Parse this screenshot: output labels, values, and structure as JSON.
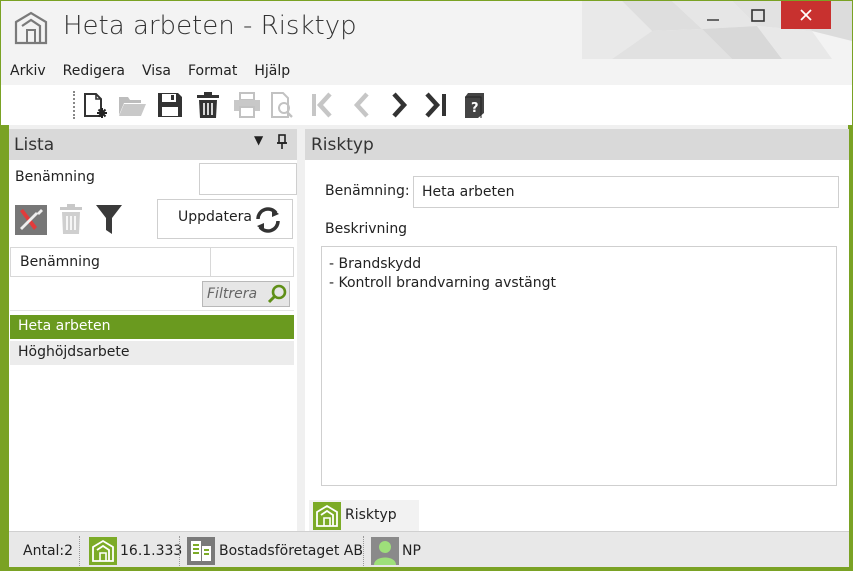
{
  "window": {
    "title": "Heta arbeten - Risktyp",
    "accent_color": "#7cab27",
    "selection_color": "#6a9a1f"
  },
  "menu": {
    "items": [
      "Arkiv",
      "Redigera",
      "Visa",
      "Format",
      "Hjälp"
    ]
  },
  "toolbar": {
    "icons": [
      "new-record-icon",
      "open-folder-icon",
      "save-icon",
      "delete-icon",
      "print-icon",
      "print-preview-icon",
      "first-record-icon",
      "previous-record-icon",
      "next-record-icon",
      "last-record-icon",
      "help-book-icon"
    ]
  },
  "left_panel": {
    "title": "Lista",
    "name_label": "Benämning",
    "name_value": "",
    "refresh_label": "Uppdatera",
    "column_header": "Benämning",
    "filter_placeholder": "Filtrera",
    "rows": [
      {
        "label": "Heta arbeten",
        "selected": true
      },
      {
        "label": "Höghöjdsarbete",
        "selected": false
      }
    ]
  },
  "right_panel": {
    "title": "Risktyp",
    "name_label": "Benämning:",
    "name_value": "Heta arbeten",
    "description_label": "Beskrivning",
    "description_lines": [
      "- Brandskydd",
      "- Kontroll brandvarning avstängt"
    ]
  },
  "tabs": [
    {
      "label": "Risktyp",
      "active": true
    }
  ],
  "statusbar": {
    "count": "Antal:2",
    "version": "16.1.333",
    "company": "Bostadsföretaget AB",
    "user": "NP"
  }
}
